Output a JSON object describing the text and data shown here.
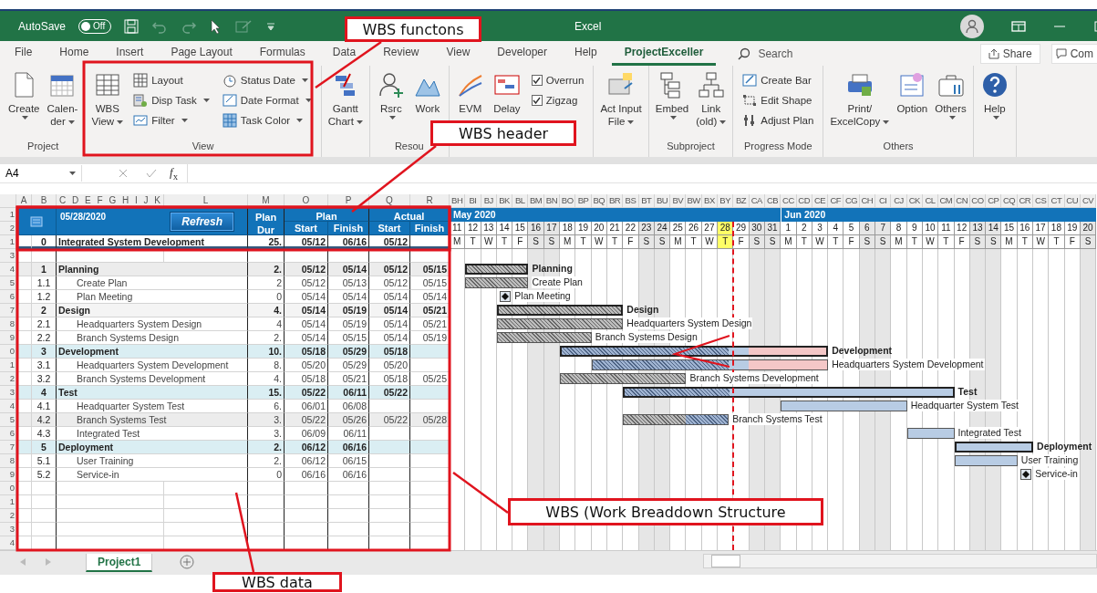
{
  "window": {
    "autosave_label": "AutoSave",
    "autosave_state": "Off",
    "autosave_on": false,
    "title": "Excel"
  },
  "ribbon_tabs": [
    {
      "label": "File",
      "selected": false
    },
    {
      "label": "Home",
      "selected": false
    },
    {
      "label": "Insert",
      "selected": false
    },
    {
      "label": "Page Layout",
      "selected": false
    },
    {
      "label": "Formulas",
      "selected": false
    },
    {
      "label": "Data",
      "selected": false
    },
    {
      "label": "Review",
      "selected": false
    },
    {
      "label": "View",
      "selected": false
    },
    {
      "label": "Developer",
      "selected": false
    },
    {
      "label": "Help",
      "selected": false
    },
    {
      "label": "ProjectExceller",
      "selected": true
    }
  ],
  "search": {
    "placeholder": "Search"
  },
  "share_button": "Share",
  "comments_button": "Com",
  "ribbon_groups": [
    {
      "label": "Project",
      "items": [
        {
          "kind": "large",
          "lines": [
            "Create"
          ],
          "dropdown": true
        },
        {
          "kind": "large",
          "lines": [
            "Calen-",
            "der"
          ],
          "dropdown": true
        }
      ]
    },
    {
      "label": "View",
      "items": [
        {
          "kind": "large",
          "lines": [
            "WBS",
            "View"
          ],
          "dropdown": true
        },
        {
          "kind": "stack",
          "items": [
            {
              "kind": "small",
              "label": "Layout",
              "dropdown": false
            },
            {
              "kind": "small",
              "label": "Disp Task",
              "dropdown": true
            },
            {
              "kind": "small",
              "label": "Filter",
              "dropdown": true
            }
          ]
        },
        {
          "kind": "stack",
          "items": [
            {
              "kind": "small",
              "label": "Status Date",
              "dropdown": true
            },
            {
              "kind": "small",
              "label": "Date Format",
              "dropdown": true
            },
            {
              "kind": "small",
              "label": "Task Color",
              "dropdown": true
            }
          ]
        }
      ]
    },
    {
      "items": [
        {
          "kind": "large",
          "lines": [
            "Gantt",
            "Chart"
          ],
          "dropdown": true
        }
      ]
    },
    {
      "label": "Resou",
      "items": [
        {
          "kind": "large",
          "lines": [
            "Rsrc"
          ],
          "dropdown": true
        },
        {
          "kind": "large",
          "lines": [
            "Work"
          ],
          "dropdown": false
        }
      ]
    },
    {
      "items": [
        {
          "kind": "large",
          "lines": [
            "EVM"
          ],
          "dropdown": false
        },
        {
          "kind": "large",
          "lines": [
            "Delay"
          ],
          "dropdown": false
        },
        {
          "kind": "stack",
          "items": [
            {
              "kind": "check",
              "label": "Overrun",
              "checked": true
            },
            {
              "kind": "check",
              "label": "Zigzag",
              "checked": true
            }
          ]
        }
      ]
    },
    {
      "items": [
        {
          "kind": "large",
          "lines": [
            "Act Input",
            "File"
          ],
          "dropdown": true
        }
      ]
    },
    {
      "label": "Subproject",
      "items": [
        {
          "kind": "large",
          "lines": [
            "Embed"
          ],
          "dropdown": true
        },
        {
          "kind": "large",
          "lines": [
            "Link",
            "(old)"
          ],
          "dropdown": true
        }
      ]
    },
    {
      "label": "Progress Mode",
      "items": [
        {
          "kind": "stack",
          "items": [
            {
              "kind": "small",
              "label": "Create Bar",
              "dropdown": false
            },
            {
              "kind": "small",
              "label": "Edit Shape",
              "dropdown": false
            },
            {
              "kind": "small",
              "label": "Adjust Plan",
              "dropdown": false
            }
          ]
        }
      ]
    },
    {
      "label": "Others",
      "items": [
        {
          "kind": "large",
          "lines": [
            "Print/",
            "ExcelCopy"
          ],
          "dropdown": true
        },
        {
          "kind": "large",
          "lines": [
            "Option"
          ],
          "dropdown": false
        },
        {
          "kind": "large",
          "lines": [
            "Others"
          ],
          "dropdown": true
        }
      ]
    },
    {
      "items": [
        {
          "kind": "large",
          "lines": [
            "Help"
          ],
          "dropdown": true
        }
      ]
    }
  ],
  "formula_bar": {
    "name_box": "A4",
    "function_label": "*f*$_{x}$"
  },
  "sheet": {
    "column_letters": [
      "A",
      "B",
      "C",
      "D",
      "E",
      "F",
      "G",
      "H",
      "I",
      "J",
      "K",
      "L",
      "M",
      "O",
      "P",
      "Q",
      "R"
    ],
    "row_numbers": [
      "1",
      "2",
      "1",
      "3",
      "4",
      "5",
      "6",
      "7",
      "8",
      "9",
      "0",
      "1",
      "2",
      "3",
      "4",
      "5",
      "6",
      "7",
      "8",
      "9",
      "0",
      "1",
      "2",
      "3",
      "4"
    ],
    "header": {
      "status_date": "05/28/2020",
      "refresh": "Refresh",
      "dur_top": "Plan",
      "dur_bottom": "Dur",
      "plan": "Plan",
      "actual": "Actual",
      "plan_cols": [
        "Start",
        "Finish"
      ],
      "actual_cols": [
        "Start",
        "Finish"
      ]
    },
    "project": {
      "wbs": "0",
      "name": "Integrated System Development",
      "dur": "25.",
      "plan_start": "05/12",
      "plan_finish": "06/16",
      "actual_start": "05/12"
    },
    "tasks": [
      {
        "kind": "summary",
        "color": "#ececec",
        "wbs": "1",
        "name": "Planning",
        "dur": "2.",
        "plan_start": "05/12",
        "plan_finish": "05/14",
        "actual_start": "05/12",
        "actual_finish": "05/15"
      },
      {
        "kind": "task",
        "color": "#ffffff",
        "wbs": "1.1",
        "name": "Create Plan",
        "dur": "2",
        "plan_start": "05/12",
        "plan_finish": "05/13",
        "actual_start": "05/12",
        "actual_finish": "05/15"
      },
      {
        "kind": "task",
        "color": "#ffffff",
        "wbs": "1.2",
        "name": "Plan Meeting",
        "dur": "0",
        "plan_start": "05/14",
        "plan_finish": "05/14",
        "actual_start": "05/14",
        "actual_finish": "05/14"
      },
      {
        "kind": "summary",
        "color": "#f4f4f4",
        "wbs": "2",
        "name": "Design",
        "dur": "4.",
        "plan_start": "05/14",
        "plan_finish": "05/19",
        "actual_start": "05/14",
        "actual_finish": "05/21"
      },
      {
        "kind": "task",
        "color": "#ffffff",
        "wbs": "2.1",
        "name": "Headquarters System Design",
        "dur": "4",
        "plan_start": "05/14",
        "plan_finish": "05/19",
        "actual_start": "05/14",
        "actual_finish": "05/21"
      },
      {
        "kind": "task",
        "color": "#ffffff",
        "wbs": "2.2",
        "name": "Branch Systems Design",
        "dur": "2.",
        "plan_start": "05/14",
        "plan_finish": "05/15",
        "actual_start": "05/14",
        "actual_finish": "05/19"
      },
      {
        "kind": "summary",
        "color": "#daeef3",
        "wbs": "3",
        "name": "Development",
        "dur": "10.",
        "plan_start": "05/18",
        "plan_finish": "05/29",
        "actual_start": "05/18"
      },
      {
        "kind": "task",
        "color": "#ffffff",
        "wbs": "3.1",
        "name": "Headquarters System Development",
        "dur": "8.",
        "plan_start": "05/20",
        "plan_finish": "05/29",
        "actual_start": "05/20"
      },
      {
        "kind": "task",
        "color": "#ffffff",
        "wbs": "3.2",
        "name": "Branch Systems Development",
        "dur": "4.",
        "plan_start": "05/18",
        "plan_finish": "05/21",
        "actual_start": "05/18",
        "actual_finish": "05/25"
      },
      {
        "kind": "summary",
        "color": "#daeef3",
        "wbs": "4",
        "name": "Test",
        "dur": "15.",
        "plan_start": "05/22",
        "plan_finish": "06/11",
        "actual_start": "05/22"
      },
      {
        "kind": "task",
        "color": "#ffffff",
        "wbs": "4.1",
        "name": "Headquarter System Test",
        "dur": "6.",
        "plan_start": "06/01",
        "plan_finish": "06/08"
      },
      {
        "kind": "task",
        "color": "#ececec",
        "wbs": "4.2",
        "name": "Branch Systems Test",
        "dur": "3.",
        "plan_start": "05/22",
        "plan_finish": "05/26",
        "actual_start": "05/22",
        "actual_finish": "05/28"
      },
      {
        "kind": "task",
        "color": "#ffffff",
        "wbs": "4.3",
        "name": "Integrated Test",
        "dur": "3.",
        "plan_start": "06/09",
        "plan_finish": "06/11"
      },
      {
        "kind": "summary",
        "color": "#daeef3",
        "wbs": "5",
        "name": "Deployment",
        "dur": "2.",
        "plan_start": "06/12",
        "plan_finish": "06/16"
      },
      {
        "kind": "task",
        "color": "#ffffff",
        "wbs": "5.1",
        "name": "User Training",
        "dur": "2.",
        "plan_start": "06/12",
        "plan_finish": "06/15"
      },
      {
        "kind": "task",
        "color": "#ffffff",
        "wbs": "5.2",
        "name": "Service-in",
        "dur": "0",
        "plan_start": "06/16",
        "plan_finish": "06/16"
      }
    ]
  },
  "gantt": {
    "column_letters": [
      "BH",
      "BI",
      "BJ",
      "BK",
      "BL",
      "BM",
      "BN",
      "BO",
      "BP",
      "BQ",
      "BR",
      "BS",
      "BT",
      "BU",
      "BV",
      "BW",
      "BX",
      "BY",
      "BZ",
      "CA",
      "CB",
      "CC",
      "CD",
      "CE",
      "CF",
      "CG",
      "CH",
      "CI",
      "CJ",
      "CK",
      "CL",
      "CM",
      "CN",
      "CO",
      "CP",
      "CQ",
      "CR",
      "CS",
      "CT",
      "CU",
      "CV"
    ],
    "months": [
      {
        "label": "May 2020",
        "days": [
          {
            "date": "11",
            "weekday": "M",
            "weekend": false,
            "today": false
          },
          {
            "date": "12",
            "weekday": "T",
            "weekend": false,
            "today": false
          },
          {
            "date": "13",
            "weekday": "W",
            "weekend": false,
            "today": false
          },
          {
            "date": "14",
            "weekday": "T",
            "weekend": false,
            "today": false
          },
          {
            "date": "15",
            "weekday": "F",
            "weekend": false,
            "today": false
          },
          {
            "date": "16",
            "weekday": "S",
            "weekend": true,
            "today": false
          },
          {
            "date": "17",
            "weekday": "S",
            "weekend": true,
            "today": false
          },
          {
            "date": "18",
            "weekday": "M",
            "weekend": false,
            "today": false
          },
          {
            "date": "19",
            "weekday": "T",
            "weekend": false,
            "today": false
          },
          {
            "date": "20",
            "weekday": "W",
            "weekend": false,
            "today": false
          },
          {
            "date": "21",
            "weekday": "T",
            "weekend": false,
            "today": false
          },
          {
            "date": "22",
            "weekday": "F",
            "weekend": false,
            "today": false
          },
          {
            "date": "23",
            "weekday": "S",
            "weekend": true,
            "today": false
          },
          {
            "date": "24",
            "weekday": "S",
            "weekend": true,
            "today": false
          },
          {
            "date": "25",
            "weekday": "M",
            "weekend": false,
            "today": false
          },
          {
            "date": "26",
            "weekday": "T",
            "weekend": false,
            "today": false
          },
          {
            "date": "27",
            "weekday": "W",
            "weekend": false,
            "today": false
          },
          {
            "date": "28",
            "weekday": "T",
            "weekend": false,
            "today": true
          },
          {
            "date": "29",
            "weekday": "F",
            "weekend": false,
            "today": false
          },
          {
            "date": "30",
            "weekday": "S",
            "weekend": true,
            "today": false
          },
          {
            "date": "31",
            "weekday": "S",
            "weekend": true,
            "today": false
          }
        ]
      },
      {
        "label": "Jun 2020",
        "days": [
          {
            "date": "1",
            "weekday": "M",
            "weekend": false,
            "today": false
          },
          {
            "date": "2",
            "weekday": "T",
            "weekend": false,
            "today": false
          },
          {
            "date": "3",
            "weekday": "W",
            "weekend": false,
            "today": false
          },
          {
            "date": "4",
            "weekday": "T",
            "weekend": false,
            "today": false
          },
          {
            "date": "5",
            "weekday": "F",
            "weekend": false,
            "today": false
          },
          {
            "date": "6",
            "weekday": "S",
            "weekend": true,
            "today": false
          },
          {
            "date": "7",
            "weekday": "S",
            "weekend": true,
            "today": false
          },
          {
            "date": "8",
            "weekday": "M",
            "weekend": false,
            "today": false
          },
          {
            "date": "9",
            "weekday": "T",
            "weekend": false,
            "today": false
          },
          {
            "date": "10",
            "weekday": "W",
            "weekend": false,
            "today": false
          },
          {
            "date": "11",
            "weekday": "T",
            "weekend": false,
            "today": false
          },
          {
            "date": "12",
            "weekday": "F",
            "weekend": false,
            "today": false
          },
          {
            "date": "13",
            "weekday": "S",
            "weekend": true,
            "today": false
          },
          {
            "date": "14",
            "weekday": "S",
            "weekend": true,
            "today": false
          },
          {
            "date": "15",
            "weekday": "M",
            "weekend": false,
            "today": false
          },
          {
            "date": "16",
            "weekday": "T",
            "weekend": false,
            "today": false
          },
          {
            "date": "17",
            "weekday": "W",
            "weekend": false,
            "today": false
          },
          {
            "date": "18",
            "weekday": "T",
            "weekend": false,
            "today": false
          },
          {
            "date": "19",
            "weekday": "F",
            "weekend": false,
            "today": false
          },
          {
            "date": "20",
            "weekday": "S",
            "weekend": true,
            "today": false
          }
        ]
      }
    ],
    "bars": [
      {
        "kind": "summary",
        "label": "Planning"
      },
      {
        "kind": "task",
        "label": "Create Plan"
      },
      {
        "kind": "milestone",
        "label": "Plan Meeting"
      },
      {
        "kind": "summary",
        "label": "Design"
      },
      {
        "kind": "task",
        "label": "Headquarters System Design"
      },
      {
        "kind": "task",
        "label": "Branch Systems Design"
      },
      {
        "kind": "summary",
        "label": "Development"
      },
      {
        "kind": "task",
        "label": "Headquarters System Development"
      },
      {
        "kind": "task",
        "label": "Branch Systems Development"
      },
      {
        "kind": "summary",
        "label": "Test"
      },
      {
        "kind": "task",
        "label": "Headquarter System Test"
      },
      {
        "kind": "task",
        "label": "Branch Systems Test"
      },
      {
        "kind": "task",
        "label": "Integrated Test"
      },
      {
        "kind": "summary",
        "label": "Deployment"
      },
      {
        "kind": "task",
        "label": "User Training"
      },
      {
        "kind": "milestone",
        "label": "Service-in"
      }
    ]
  },
  "sheet_tabs": [
    {
      "label": "Project1",
      "selected": true
    }
  ],
  "annotations": [
    {
      "label": "WBS functons"
    },
    {
      "label": "WBS header"
    },
    {
      "label": "WBS (Work Breaddown Structure"
    },
    {
      "label": "WBS data"
    }
  ]
}
